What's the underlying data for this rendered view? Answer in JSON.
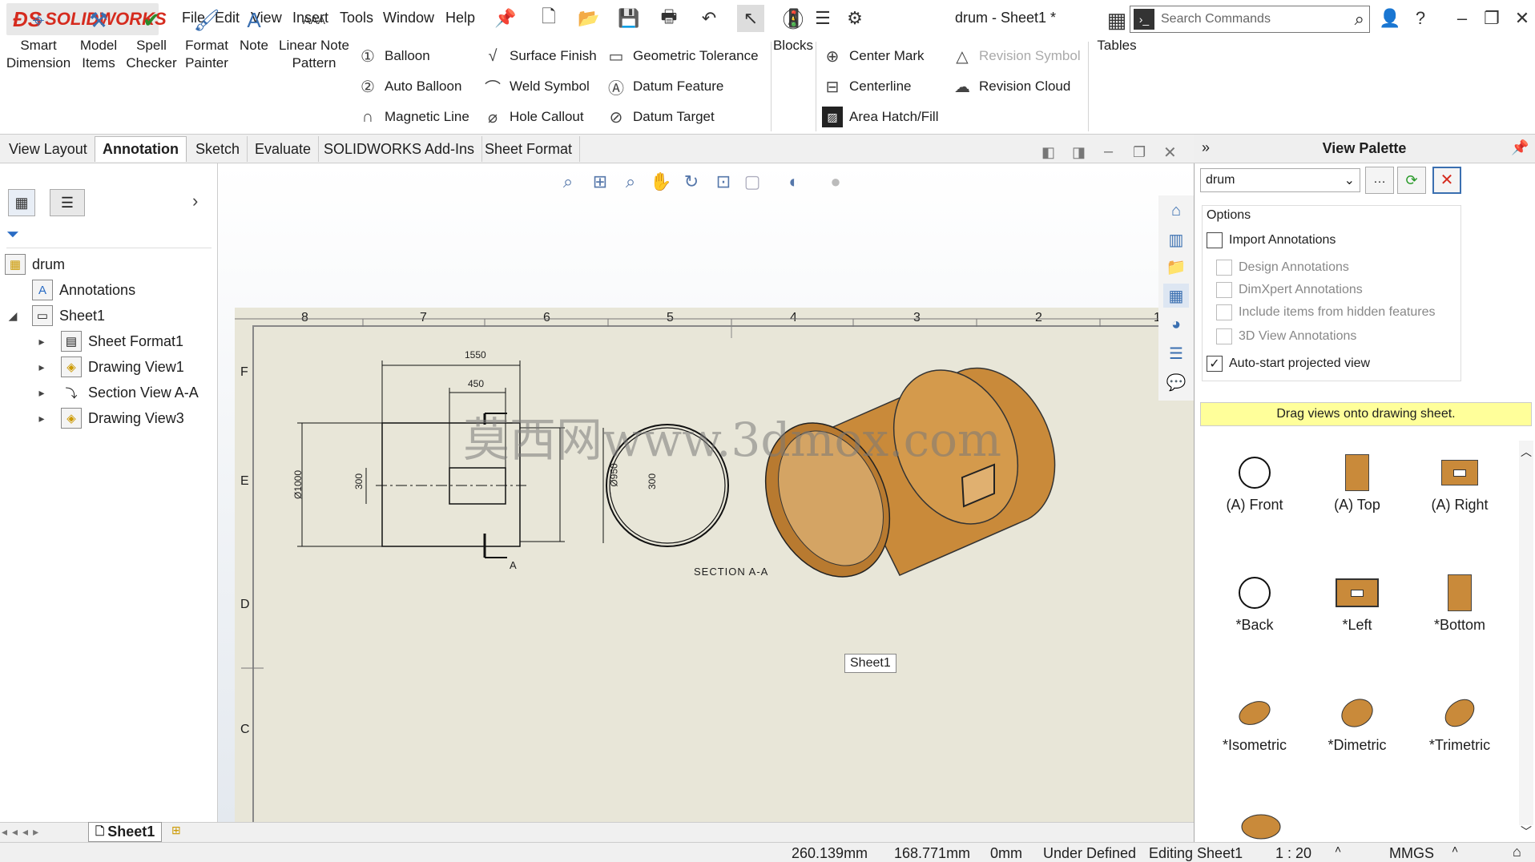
{
  "app": {
    "brand": "SOLIDWORKS",
    "doc_title": "drum - Sheet1 *"
  },
  "menu": [
    "File",
    "Edit",
    "View",
    "Insert",
    "Tools",
    "Window",
    "Help"
  ],
  "search": {
    "placeholder": "Search Commands"
  },
  "ribbon": {
    "smart_dimension": "Smart Dimension",
    "model_items": "Model Items",
    "spell_checker": "Spell Checker",
    "format_painter": "Format Painter",
    "note": "Note",
    "linear_note_pattern": "Linear Note Pattern",
    "balloon": "Balloon",
    "auto_balloon": "Auto Balloon",
    "magnetic_line": "Magnetic Line",
    "surface_finish": "Surface Finish",
    "weld_symbol": "Weld Symbol",
    "hole_callout": "Hole Callout",
    "geometric_tolerance": "Geometric Tolerance",
    "datum_feature": "Datum Feature",
    "datum_target": "Datum Target",
    "blocks": "Blocks",
    "center_mark": "Center Mark",
    "centerline": "Centerline",
    "area_hatch": "Area Hatch/Fill",
    "revision_symbol": "Revision Symbol",
    "revision_cloud": "Revision Cloud",
    "tables": "Tables"
  },
  "tabs": [
    "View Layout",
    "Annotation",
    "Sketch",
    "Evaluate",
    "SOLIDWORKS Add-Ins",
    "Sheet Format"
  ],
  "active_tab": "Annotation",
  "tree": {
    "root": "drum",
    "items": [
      {
        "label": "Annotations"
      },
      {
        "label": "Sheet1"
      },
      {
        "label": "Sheet Format1"
      },
      {
        "label": "Drawing View1"
      },
      {
        "label": "Section View A-A"
      },
      {
        "label": "Drawing View3"
      }
    ]
  },
  "drawing": {
    "ruler_numbers": [
      "8",
      "7",
      "6",
      "5",
      "4",
      "3",
      "2",
      "1"
    ],
    "zone_letters": [
      "F",
      "E",
      "D",
      "C"
    ],
    "dim_1550": "1550",
    "dim_450": "450",
    "dim_1000": "Ø1000",
    "dim_300a": "300",
    "dim_950": "Ø950",
    "dim_300b": "300",
    "section_label": "A",
    "section_title": "SECTION A-A",
    "sheet_tooltip": "Sheet1",
    "watermark": "莫西网www.3dmox.com"
  },
  "palette": {
    "title": "View Palette",
    "selected": "drum",
    "options_label": "Options",
    "import_annotations": "Import Annotations",
    "design_annotations": "Design Annotations",
    "dimxpert_annotations": "DimXpert Annotations",
    "hidden_features": "Include items from hidden features",
    "view_3d_annotations": "3D View Annotations",
    "auto_start": "Auto-start projected view",
    "drag_hint": "Drag views onto drawing sheet.",
    "views": [
      "(A) Front",
      "(A) Top",
      "(A) Right",
      "*Back",
      "*Left",
      "*Bottom",
      "*Isometric",
      "*Dimetric",
      "*Trimetric"
    ]
  },
  "sheet_tab": "Sheet1",
  "status": {
    "x": "260.139mm",
    "y": "168.771mm",
    "z": "0mm",
    "state": "Under Defined",
    "editing": "Editing Sheet1",
    "scale": "1 : 20",
    "units": "MMGS"
  },
  "colors": {
    "brand_red": "#d52b1e",
    "wood": "#c98a3a",
    "sheet": "#e8e6d8",
    "hint_yellow": "#ffff9a"
  }
}
